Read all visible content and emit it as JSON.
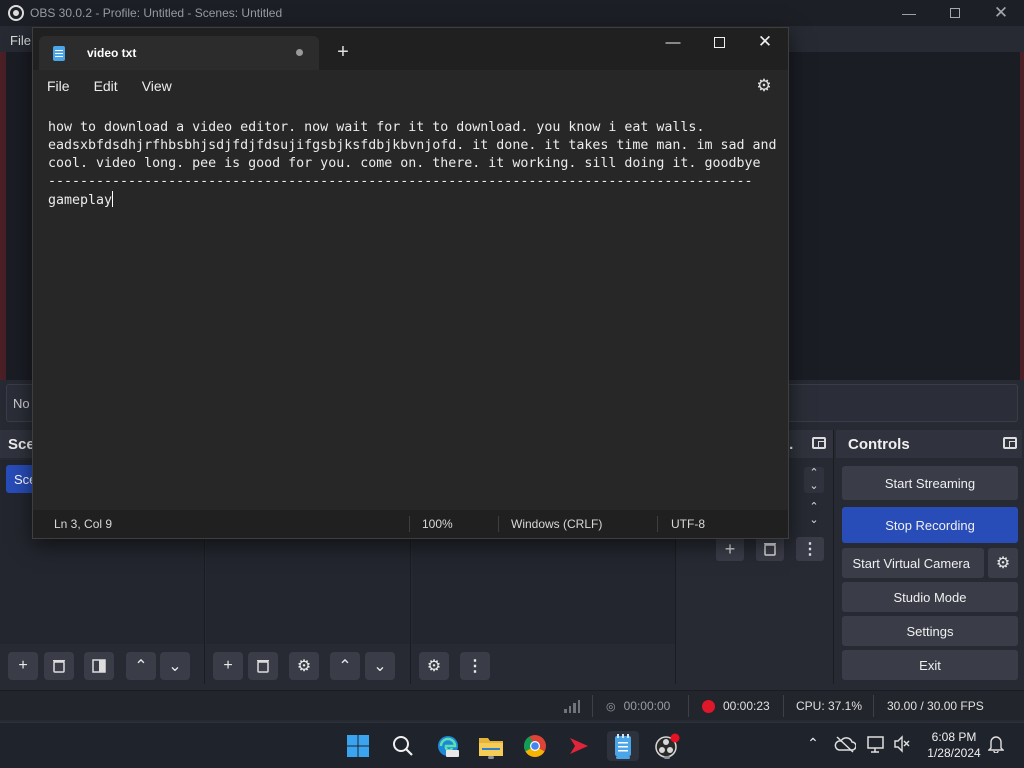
{
  "obs": {
    "title": "OBS 30.0.2 - Profile: Untitled - Scenes: Untitled",
    "menu_file": "File",
    "no_source_label": "No",
    "scenes_header": "Sce",
    "scene_item": "Sce",
    "controls": {
      "header": "Controls",
      "start_streaming": "Start Streaming",
      "stop_recording": "Stop Recording",
      "start_virtual_camera": "Start Virtual Camera",
      "studio_mode": "Studio Mode",
      "settings": "Settings",
      "exit": "Exit"
    },
    "statusbar": {
      "stream_time": "00:00:00",
      "rec_time": "00:00:23",
      "cpu": "CPU: 37.1%",
      "fps": "30.00 / 30.00 FPS"
    },
    "colors": {
      "accent": "#284cb8",
      "recording": "#e0162b"
    }
  },
  "notepad": {
    "tab_title": "video txt",
    "menu": {
      "file": "File",
      "edit": "Edit",
      "view": "View"
    },
    "lines": [
      "how to download a video editor. now wait for it to download. you know i eat walls.",
      "eadsxbfdsdhjrfhbsbhjsdjfdjfdsujifgsbjksfdbjkbvnjofd. it done. it takes time man. im sad and",
      "cool. video long. pee is good for you. come on. there. it working. sill doing it. goodbye",
      "----------------------------------------------------------------------------------------"
    ],
    "last_line": "gameplay",
    "status": {
      "position": "Ln 3, Col 9",
      "zoom": "100%",
      "line_ending": "Windows (CRLF)",
      "encoding": "UTF-8"
    }
  },
  "taskbar": {
    "time": "6:08 PM",
    "date": "1/28/2024",
    "icons": [
      "windows-start-icon",
      "search-icon",
      "edge-icon",
      "file-explorer-icon",
      "chrome-icon",
      "video-editor-icon",
      "notepad-icon",
      "obs-icon"
    ]
  }
}
